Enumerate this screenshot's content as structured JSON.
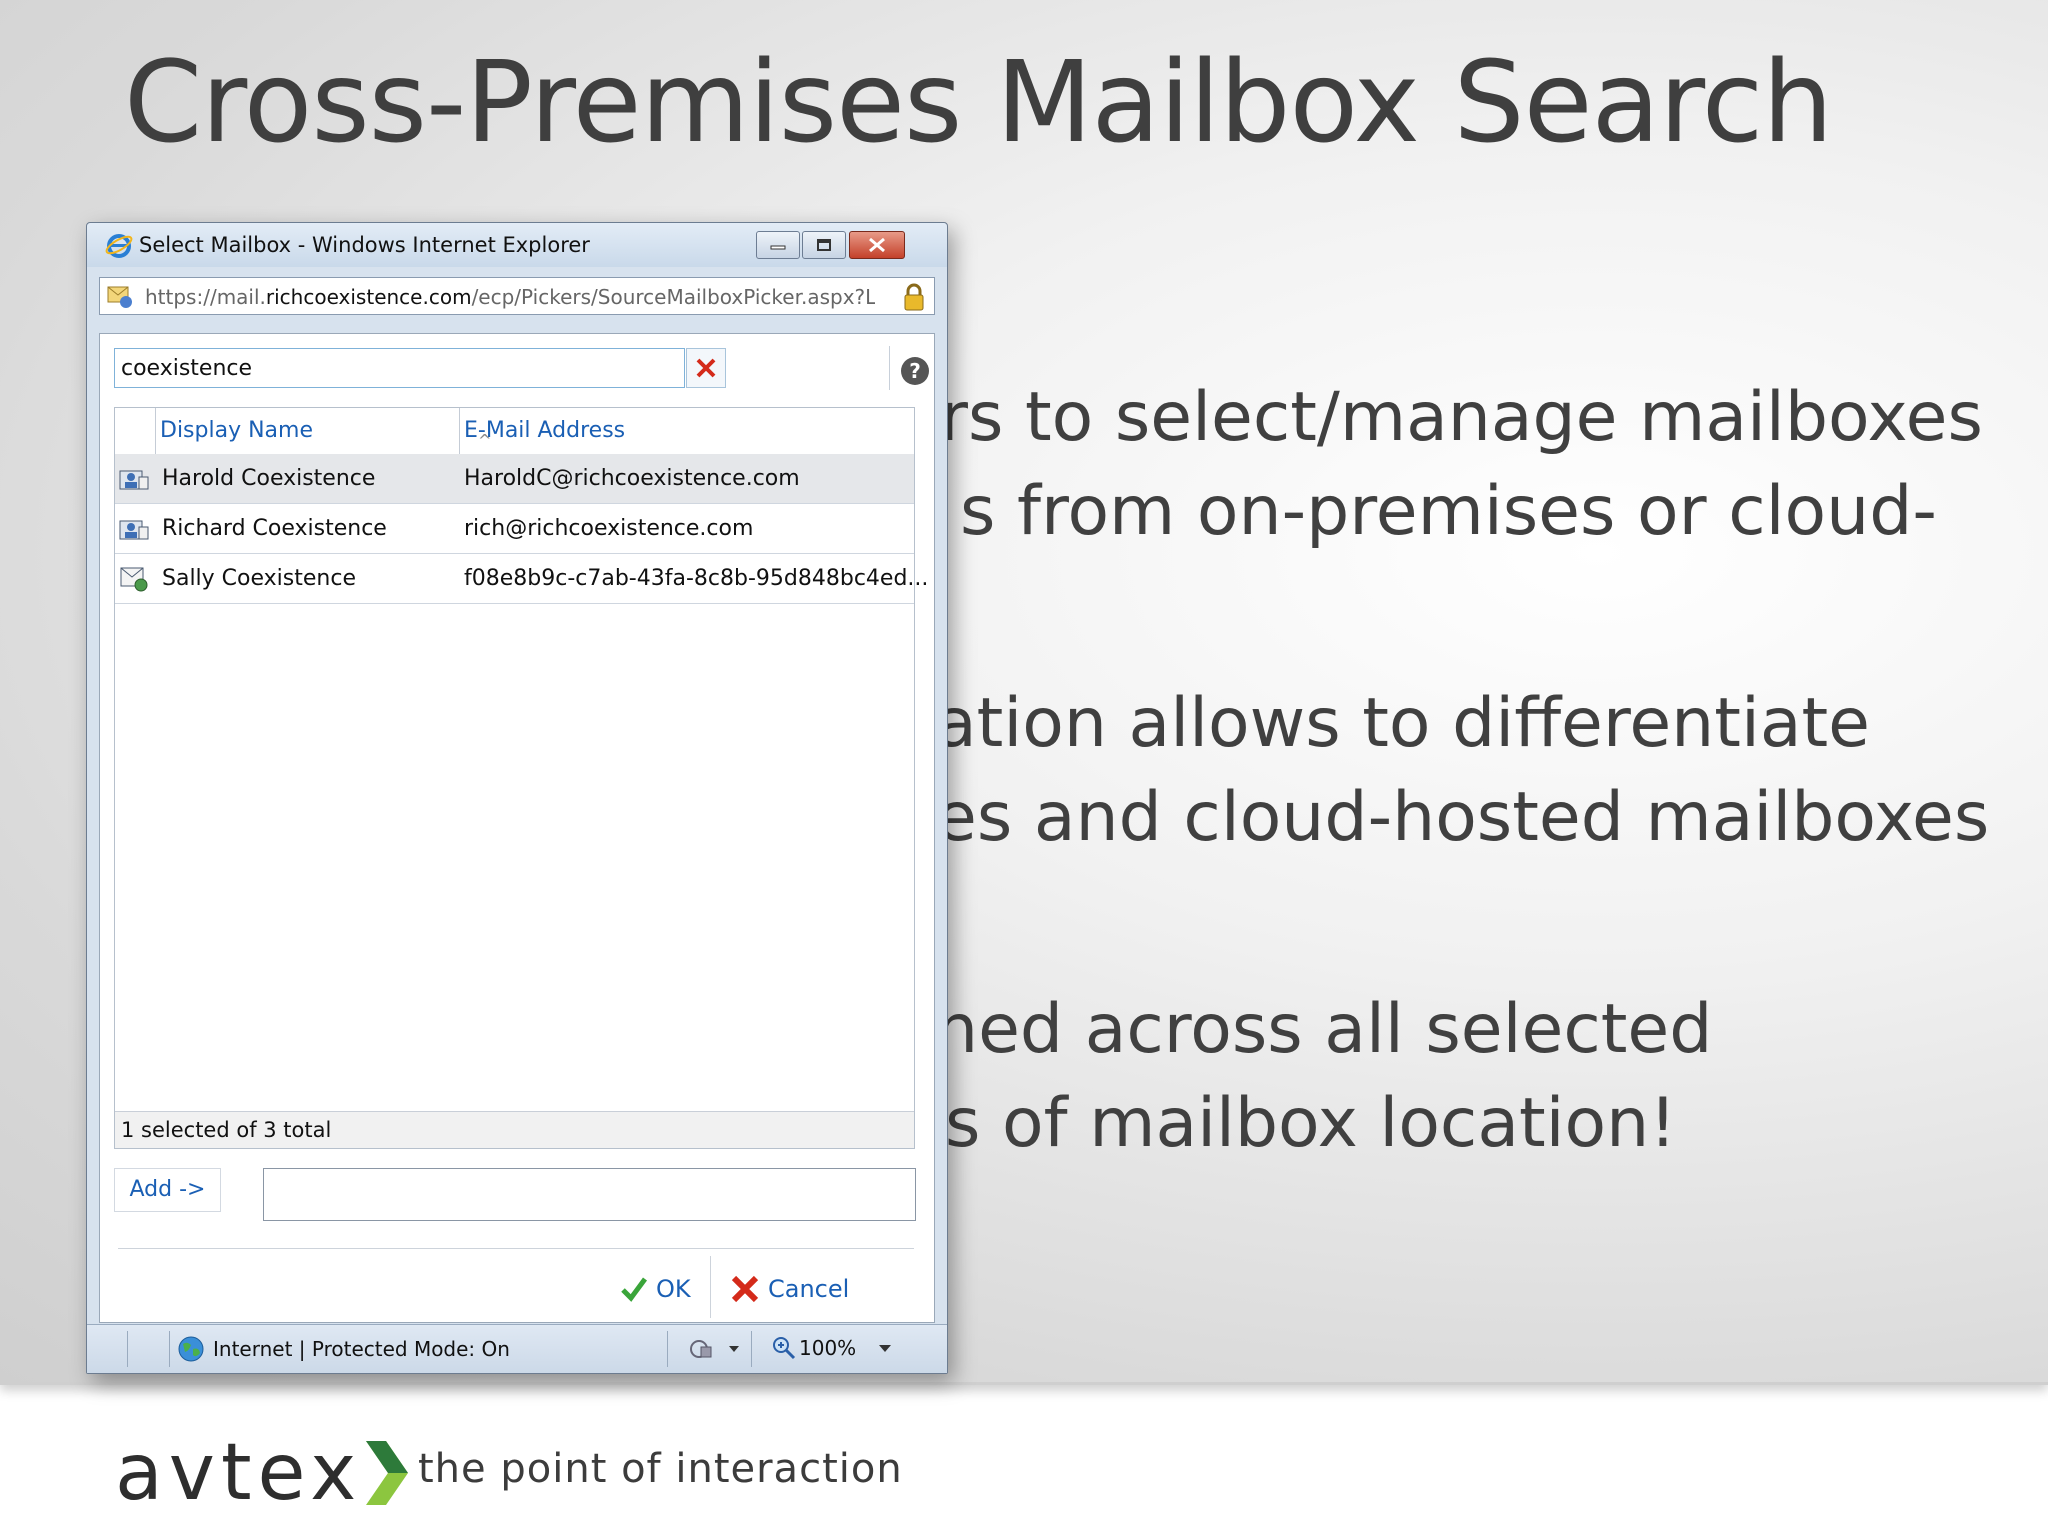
{
  "slide": {
    "title": "Cross-Premises Mailbox Search",
    "bullets": [
      "rs to select/manage mailboxes",
      "s from on-premises or cloud-",
      "ation allows to differentiate",
      "es and cloud-hosted mailboxes",
      "ned across all selected",
      "s of mailbox location!"
    ]
  },
  "footer": {
    "logo_text": "avtex",
    "tagline": "the point of interaction"
  },
  "window": {
    "title": "Select Mailbox - Windows Internet Explorer",
    "url_prefix": "https://mail.",
    "url_domain": "richcoexistence.com",
    "url_rest": "/ecp/Pickers/SourceMailboxPicker.aspx?La",
    "search_value": "coexistence",
    "columns": {
      "display_name": "Display Name",
      "email": "E-Mail Address"
    },
    "rows": [
      {
        "name": "Harold Coexistence",
        "email": "HaroldC@richcoexistence.com",
        "icon": "user-mailbox-icon",
        "selected": true
      },
      {
        "name": "Richard Coexistence",
        "email": "rich@richcoexistence.com",
        "icon": "user-mailbox-icon",
        "selected": false
      },
      {
        "name": "Sally Coexistence",
        "email": "f08e8b9c-c7ab-43fa-8c8b-95d848bc4ed...",
        "icon": "remote-mailbox-icon",
        "selected": false
      }
    ],
    "status": "1 selected of 3 total",
    "add_label": "Add ->",
    "ok_label": "OK",
    "cancel_label": "Cancel",
    "statusbar_text": "Internet | Protected Mode: On",
    "zoom": "100%"
  },
  "colors": {
    "link_blue": "#1a5fb4",
    "ok_green": "#3aa53a",
    "cancel_red": "#d42a1a"
  }
}
